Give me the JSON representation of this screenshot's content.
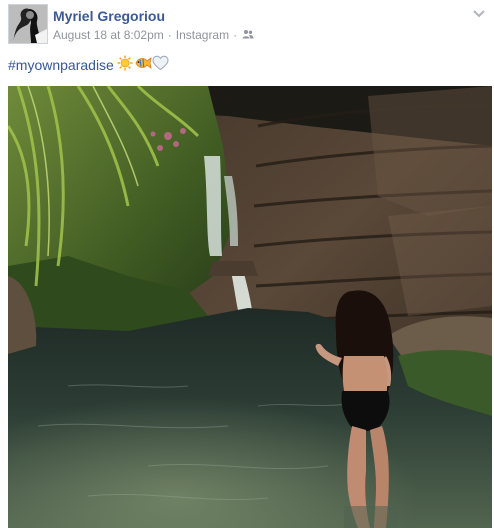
{
  "post": {
    "author_name": "Myriel Gregoriou",
    "timestamp": "August 18 at 8:02pm",
    "separator": "·",
    "source": "Instagram",
    "audience_icon": "friends-icon",
    "options_icon": "chevron-down-icon",
    "caption": {
      "hashtag": "#myownparadise",
      "emojis": [
        "sun-emoji",
        "tropical-fish-emoji",
        "white-heart-emoji"
      ]
    },
    "photo": {
      "subject": "woman-in-black-swimsuit-standing-in-river-pool-by-waterfall"
    }
  },
  "colors": {
    "author_link": "#3b5998",
    "hashtag_link": "#365899",
    "meta_text": "#90949c",
    "body_text": "#1d2129"
  }
}
